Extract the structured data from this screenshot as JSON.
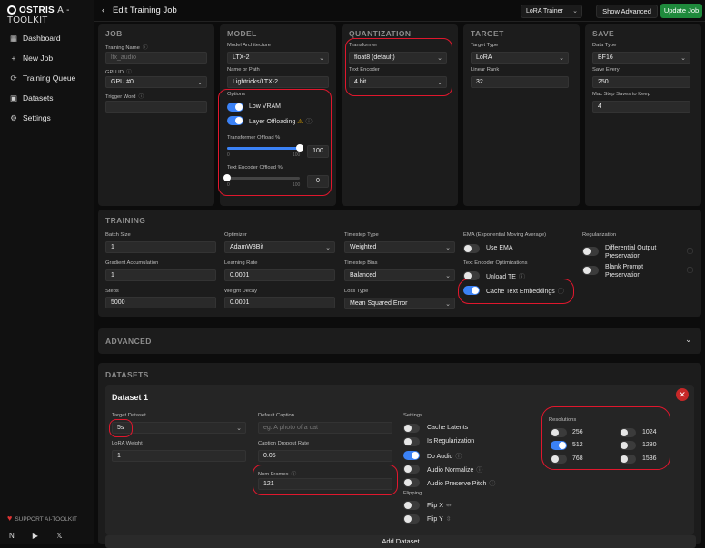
{
  "app": {
    "brand": "OSTRIS",
    "product": "AI-TOOLKIT"
  },
  "sidebar": {
    "items": [
      {
        "label": "Dashboard",
        "icon": "dashboard-icon"
      },
      {
        "label": "New Job",
        "icon": "plus-icon"
      },
      {
        "label": "Training Queue",
        "icon": "queue-icon"
      },
      {
        "label": "Datasets",
        "icon": "image-icon"
      },
      {
        "label": "Settings",
        "icon": "gear-icon"
      }
    ],
    "support": "SUPPORT AI-TOOLKIT",
    "social_letters": "N"
  },
  "header": {
    "title": "Edit Training Job",
    "trainer": "LoRA Trainer",
    "show_advanced": "Show Advanced",
    "update": "Update Job"
  },
  "job": {
    "title": "JOB",
    "training_name_label": "Training Name",
    "training_name": "ltx_audio",
    "gpu_label": "GPU ID",
    "gpu": "GPU #0",
    "trigger_label": "Trigger Word",
    "trigger": ""
  },
  "model": {
    "title": "MODEL",
    "arch_label": "Model Architecture",
    "arch": "LTX-2",
    "path_label": "Name or Path",
    "path": "Lightricks/LTX-2",
    "options_label": "Options",
    "low_vram": "Low VRAM",
    "layer_offloading": "Layer Offloading",
    "transformer_offload_label": "Transformer Offload %",
    "transformer_offload": 100,
    "text_encoder_offload_label": "Text Encoder Offload %",
    "text_encoder_offload": 0,
    "tick_min": "0",
    "tick_max": "100"
  },
  "quant": {
    "title": "QUANTIZATION",
    "transformer_label": "Transformer",
    "transformer": "float8 (default)",
    "text_encoder_label": "Text Encoder",
    "text_encoder": "4 bit"
  },
  "target": {
    "title": "TARGET",
    "type_label": "Target Type",
    "type": "LoRA",
    "rank_label": "Linear Rank",
    "rank": "32"
  },
  "save": {
    "title": "SAVE",
    "dtype_label": "Data Type",
    "dtype": "BF16",
    "every_label": "Save Every",
    "every": "250",
    "max_label": "Max Step Saves to Keep",
    "max": "4"
  },
  "training": {
    "title": "TRAINING",
    "batch_label": "Batch Size",
    "batch": "1",
    "grad_label": "Gradient Accumulation",
    "grad": "1",
    "steps_label": "Steps",
    "steps": "5000",
    "opt_label": "Optimizer",
    "opt": "AdamW8Bit",
    "lr_label": "Learning Rate",
    "lr": "0.0001",
    "wd_label": "Weight Decay",
    "wd": "0.0001",
    "ts_type_label": "Timestep Type",
    "ts_type": "Weighted",
    "ts_bias_label": "Timestep Bias",
    "ts_bias": "Balanced",
    "loss_label": "Loss Type",
    "loss": "Mean Squared Error",
    "ema_label": "EMA (Exponential Moving Average)",
    "use_ema": "Use EMA",
    "te_opt_label": "Text Encoder Optimizations",
    "unload_te": "Unload TE",
    "cache_te": "Cache Text Embeddings",
    "reg_label": "Regularization",
    "diff_pres": "Differential Output Preservation",
    "blank_prompt": "Blank Prompt Preservation"
  },
  "advanced": {
    "title": "ADVANCED"
  },
  "datasets": {
    "title": "DATASETS",
    "dataset_title": "Dataset 1",
    "target_label": "Target Dataset",
    "target": "5s",
    "lora_weight_label": "LoRA Weight",
    "lora_weight": "1",
    "default_caption_label": "Default Caption",
    "default_caption_ph": "eg. A photo of a cat",
    "dropout_label": "Caption Dropout Rate",
    "dropout": "0.05",
    "num_frames_label": "Num Frames",
    "num_frames": "121",
    "settings_label": "Settings",
    "cache_latents": "Cache Latents",
    "is_reg": "Is Regularization",
    "do_audio": "Do Audio",
    "audio_norm": "Audio Normalize",
    "audio_pitch": "Audio Preserve Pitch",
    "flipping_label": "Flipping",
    "flip_x": "Flip X",
    "flip_y": "Flip Y",
    "resolutions_label": "Resolutions",
    "res": [
      "256",
      "512",
      "768",
      "1024",
      "1280",
      "1536"
    ],
    "add": "Add Dataset"
  },
  "colors": {
    "accent": "#3b82f6",
    "annotation": "#e0172d",
    "update": "#1f8a3c"
  }
}
